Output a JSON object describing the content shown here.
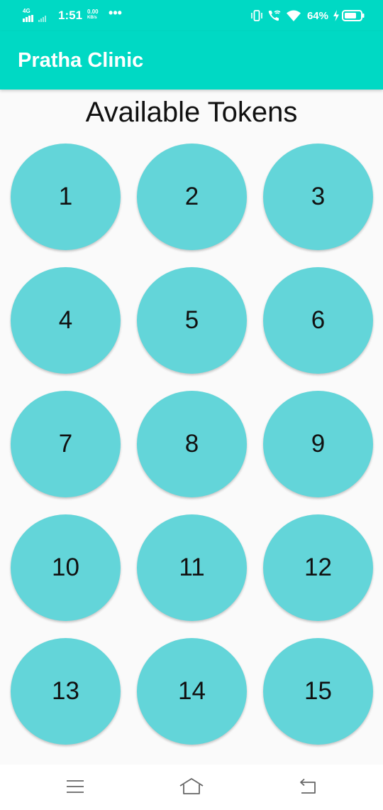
{
  "status_bar": {
    "network_type": "4G",
    "time": "1:51",
    "speed_value": "0.00",
    "speed_unit": "KB/s",
    "more_indicator": "•••",
    "battery_percent": "64%",
    "icons": [
      "signal-icon",
      "vibrate-icon",
      "wifi-call-icon",
      "wifi-icon",
      "charging-icon",
      "battery-icon"
    ]
  },
  "app_bar": {
    "title": "Pratha Clinic"
  },
  "main": {
    "heading": "Available Tokens",
    "tokens": [
      "1",
      "2",
      "3",
      "4",
      "5",
      "6",
      "7",
      "8",
      "9",
      "10",
      "11",
      "12",
      "13",
      "14",
      "15"
    ]
  },
  "nav_bar": {
    "icons": [
      "menu-icon",
      "home-icon",
      "back-icon"
    ]
  },
  "colors": {
    "primary": "#00d9c4",
    "token_fill": "#63d5d9",
    "background": "#fafafa"
  }
}
